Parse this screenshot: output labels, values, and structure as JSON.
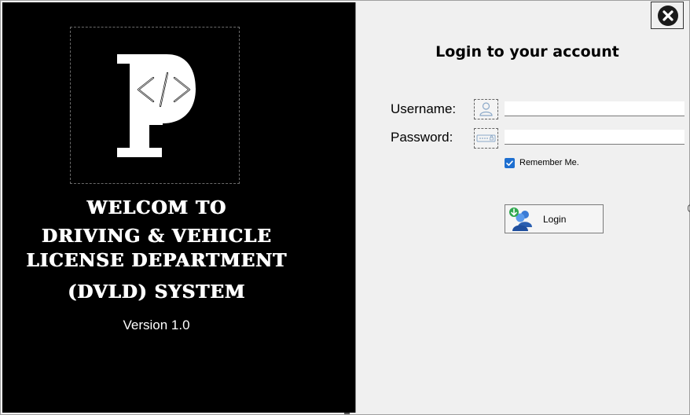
{
  "welcome_panel": {
    "logo_letter": "P",
    "logo_code_glyph": "</>",
    "lines": [
      "WELCOM TO",
      "DRIVING & VEHICLE",
      "LICENSE DEPARTMENT",
      "(DVLD) SYSTEM"
    ],
    "version": "Version 1.0"
  },
  "login": {
    "title": "Login to your account",
    "username_label": "Username:",
    "username_value": "",
    "password_label": "Password:",
    "password_value": "",
    "remember_label": "Remember Me.",
    "remember_checked": true,
    "login_button_label": "Login"
  },
  "icons": {
    "close": "close-icon",
    "user": "user-icon",
    "password": "password-icon",
    "login": "login-users-icon"
  },
  "colors": {
    "left_panel_bg": "#000000",
    "form_bg": "#f0f0f0",
    "checkbox_accent": "#1e6fd0"
  }
}
